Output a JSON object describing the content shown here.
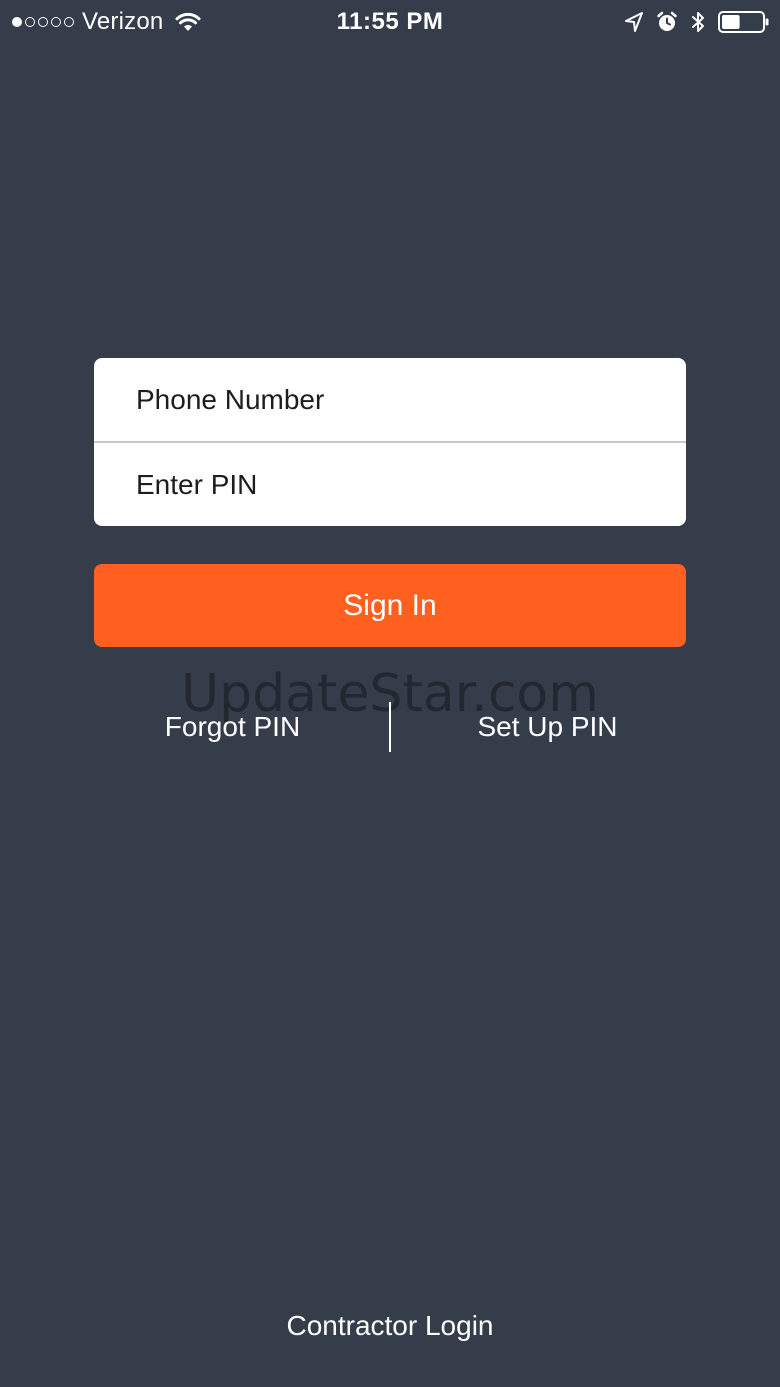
{
  "status_bar": {
    "carrier": "Verizon",
    "time": "11:55 PM",
    "signal_strength": "1 of 5",
    "icons": [
      "signal-dots-icon",
      "wifi-icon",
      "location-arrow-icon",
      "alarm-clock-icon",
      "bluetooth-icon",
      "battery-icon"
    ],
    "battery_level": 0.45
  },
  "login_form": {
    "phone_placeholder": "Phone Number",
    "pin_placeholder": "Enter PIN",
    "sign_in_label": "Sign In"
  },
  "links": {
    "forgot_pin": "Forgot PIN",
    "setup_pin": "Set Up PIN",
    "contractor_login": "Contractor Login"
  },
  "watermark": "UpdateStar.com",
  "colors": {
    "background": "#363d4a",
    "accent": "#ff5f1f",
    "card": "#ffffff",
    "text": "#ffffff"
  }
}
